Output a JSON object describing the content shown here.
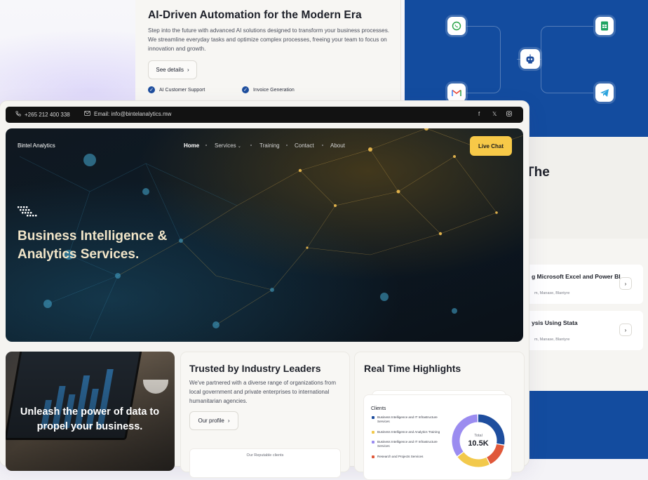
{
  "automation": {
    "title": "AI-Driven Automation for the Modern Era",
    "description": "Step into the future with advanced AI solutions designed to transform your business processes. We streamline everyday tasks and optimize complex processes, freeing your team to focus on innovation and growth.",
    "button_label": "See details",
    "features": [
      "AI Customer Support",
      "Invoice Generation"
    ]
  },
  "integrations": {
    "icons": [
      "whatsapp-icon",
      "google-sheets-icon",
      "bot-icon",
      "gmail-icon",
      "telegram-icon"
    ]
  },
  "training_panel": {
    "heading_fragment": "The",
    "items": [
      {
        "title": "g Microsoft Excel and Power BI",
        "location": "m, Manase, Blantyre"
      },
      {
        "title": "ysis Using Stata",
        "location": "m, Manase, Blantyre"
      }
    ]
  },
  "topbar": {
    "phone": "+265 212 400 338",
    "email": "Email: info@bintelanalytics.mw",
    "social_icons": [
      "facebook-icon",
      "x-icon",
      "instagram-icon"
    ]
  },
  "header": {
    "brand": "Bintel Analytics",
    "nav": [
      "Home",
      "Services",
      "Training",
      "Contact",
      "About"
    ],
    "live_chat": "Live Chat"
  },
  "hero": {
    "title": "Business Intelligence & Analytics Services."
  },
  "image_card": {
    "text": "Unleash the power of data to propel your business."
  },
  "trust": {
    "title": "Trusted by Industry Leaders",
    "description": "We've partnered with a diverse range of organizations from local government and private enterprises to international humanitarian agencies.",
    "button_label": "Our profile",
    "clients_label": "Our Reputable clients"
  },
  "highlights": {
    "title": "Real Time Highlights",
    "clients_label": "Clients",
    "total_label": "Total",
    "total_value": "10.5K",
    "legend": [
      {
        "label": "Business Intelligence and IT Infrastructure Services",
        "color": "#1e4e9e"
      },
      {
        "label": "Business Intelligence and Analytics Training",
        "color": "#f2c94c"
      },
      {
        "label": "Business Intelligence and IT Infrastructure Services",
        "color": "#9b8cf0"
      },
      {
        "label": "Research and Projects Services",
        "color": "#e0583a"
      }
    ],
    "donut_shares": [
      0.28,
      0.22,
      0.35,
      0.15
    ]
  }
}
